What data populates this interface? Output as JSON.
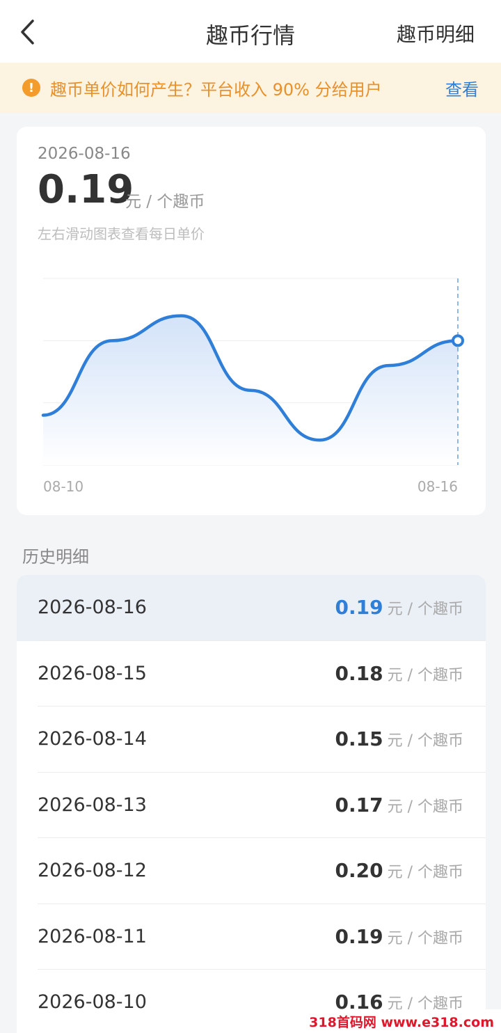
{
  "header": {
    "title": "趣币行情",
    "right_link": "趣币明细"
  },
  "notice": {
    "icon": "!",
    "text": "趣币单价如何产生？平台收入 90% 分给用户",
    "link": "查看"
  },
  "summary": {
    "date": "2026-08-16",
    "price": "0.19",
    "unit": "元 / 个趣币",
    "hint": "左右滑动图表查看每日单价"
  },
  "chart_data": {
    "type": "area",
    "categories": [
      "08-10",
      "08-11",
      "08-12",
      "08-13",
      "08-14",
      "08-15",
      "08-16"
    ],
    "values": [
      0.16,
      0.19,
      0.2,
      0.17,
      0.15,
      0.18,
      0.19
    ],
    "x_tick_labels": [
      "08-10",
      "08-16"
    ],
    "ylim": [
      0.14,
      0.215
    ],
    "grid": true,
    "highlight_index": 6,
    "colors": {
      "line": "#2f7fd8",
      "fill_top": "#cfe0f8",
      "fill_bottom": "#ffffff",
      "grid": "#eeeeee"
    }
  },
  "history": {
    "title": "历史明细",
    "unit": "元 / 个趣币",
    "rows": [
      {
        "date": "2026-08-16",
        "price": "0.19",
        "active": true
      },
      {
        "date": "2026-08-15",
        "price": "0.18",
        "active": false
      },
      {
        "date": "2026-08-14",
        "price": "0.15",
        "active": false
      },
      {
        "date": "2026-08-13",
        "price": "0.17",
        "active": false
      },
      {
        "date": "2026-08-12",
        "price": "0.20",
        "active": false
      },
      {
        "date": "2026-08-11",
        "price": "0.19",
        "active": false
      },
      {
        "date": "2026-08-10",
        "price": "0.16",
        "active": false
      }
    ]
  },
  "watermark": "318首码网 www.e318.com",
  "colors": {
    "accent": "#2f7fd8",
    "notice_bg": "#fdf3e1",
    "notice_text": "#e8902a",
    "warning_icon": "#f39c2b"
  }
}
